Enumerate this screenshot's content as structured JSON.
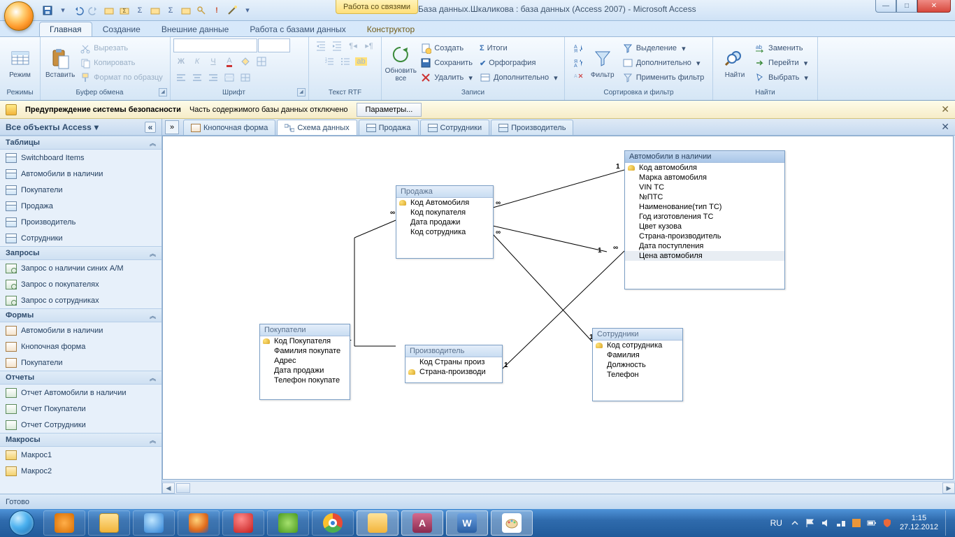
{
  "title": {
    "context_label": "Работа со связями",
    "app_title": "База данных.Шкаликова : база данных (Access 2007) - Microsoft Access"
  },
  "ribbon_tabs": {
    "t0": "Главная",
    "t1": "Создание",
    "t2": "Внешние данные",
    "t3": "Работа с базами данных",
    "t4": "Конструктор"
  },
  "ribbon": {
    "modes": {
      "label": "Режимы",
      "btn": "Режим"
    },
    "clipboard": {
      "label": "Буфер обмена",
      "paste": "Вставить",
      "cut": "Вырезать",
      "copy": "Копировать",
      "format_painter": "Формат по образцу"
    },
    "font": {
      "label": "Шрифт"
    },
    "rtf": {
      "label": "Текст RTF"
    },
    "records": {
      "label": "Записи",
      "refresh": "Обновить\nвсе",
      "new": "Создать",
      "save": "Сохранить",
      "delete": "Удалить",
      "totals": "Итоги",
      "spelling": "Орфография",
      "more": "Дополнительно"
    },
    "sort": {
      "label": "Сортировка и фильтр",
      "filter": "Фильтр",
      "selection": "Выделение",
      "advanced": "Дополнительно",
      "toggle": "Применить фильтр"
    },
    "find": {
      "label": "Найти",
      "find_btn": "Найти",
      "replace": "Заменить",
      "goto": "Перейти",
      "select": "Выбрать"
    }
  },
  "security": {
    "title": "Предупреждение системы безопасности",
    "msg": "Часть содержимого базы данных отключено",
    "btn": "Параметры..."
  },
  "nav": {
    "title": "Все объекты Access",
    "sections": {
      "tables": "Таблицы",
      "queries": "Запросы",
      "forms": "Формы",
      "reports": "Отчеты",
      "macros": "Макросы"
    },
    "tables": [
      "Switchboard Items",
      "Автомобили в наличии",
      "Покупатели",
      "Продажа",
      "Производитель",
      "Сотрудники"
    ],
    "queries": [
      "Запрос о наличии синих А/М",
      "Запрос о покупателях",
      "Запрос о сотрудниках"
    ],
    "forms": [
      "Автомобили в наличии",
      "Кнопочная форма",
      "Покупатели"
    ],
    "reports": [
      "Отчет Автомобили в наличии",
      "Отчет Покупатели",
      "Отчет Сотрудники"
    ],
    "macros": [
      "Макрос1",
      "Макрос2"
    ]
  },
  "doc_tabs": {
    "t0": "Кнопочная форма",
    "t1": "Схема данных",
    "t2": "Продажа",
    "t3": "Сотрудники",
    "t4": "Производитель"
  },
  "diagram": {
    "sale": {
      "title": "Продажа",
      "f0": "Код Автомобиля",
      "f1": "Код покупателя",
      "f2": "Дата продажи",
      "f3": "Код сотрудника"
    },
    "cars": {
      "title": "Автомобили в наличии",
      "f0": "Код автомобиля",
      "f1": "Марка автомобиля",
      "f2": "VIN ТС",
      "f3": "№ПТС",
      "f4": "Наименование(тип ТС)",
      "f5": "Год изготовления ТС",
      "f6": "Цвет кузова",
      "f7": "Страна-производитель",
      "f8": "Дата поступления",
      "f9": "Цена автомобиля"
    },
    "buyers": {
      "title": "Покупатели",
      "f0": "Код Покупателя",
      "f1": "Фамилия покупате",
      "f2": "Адрес",
      "f3": "Дата продажи",
      "f4": "Телефон покупате"
    },
    "maker": {
      "title": "Производитель",
      "f0": "Код Страны произ",
      "f1": "Страна-производи"
    },
    "staff": {
      "title": "Сотрудники",
      "f0": "Код сотрудника",
      "f1": "Фамилия",
      "f2": "Должность",
      "f3": "Телефон"
    }
  },
  "status": {
    "text": "Готово"
  },
  "tray": {
    "lang": "RU",
    "time": "1:15",
    "date": "27.12.2012"
  }
}
